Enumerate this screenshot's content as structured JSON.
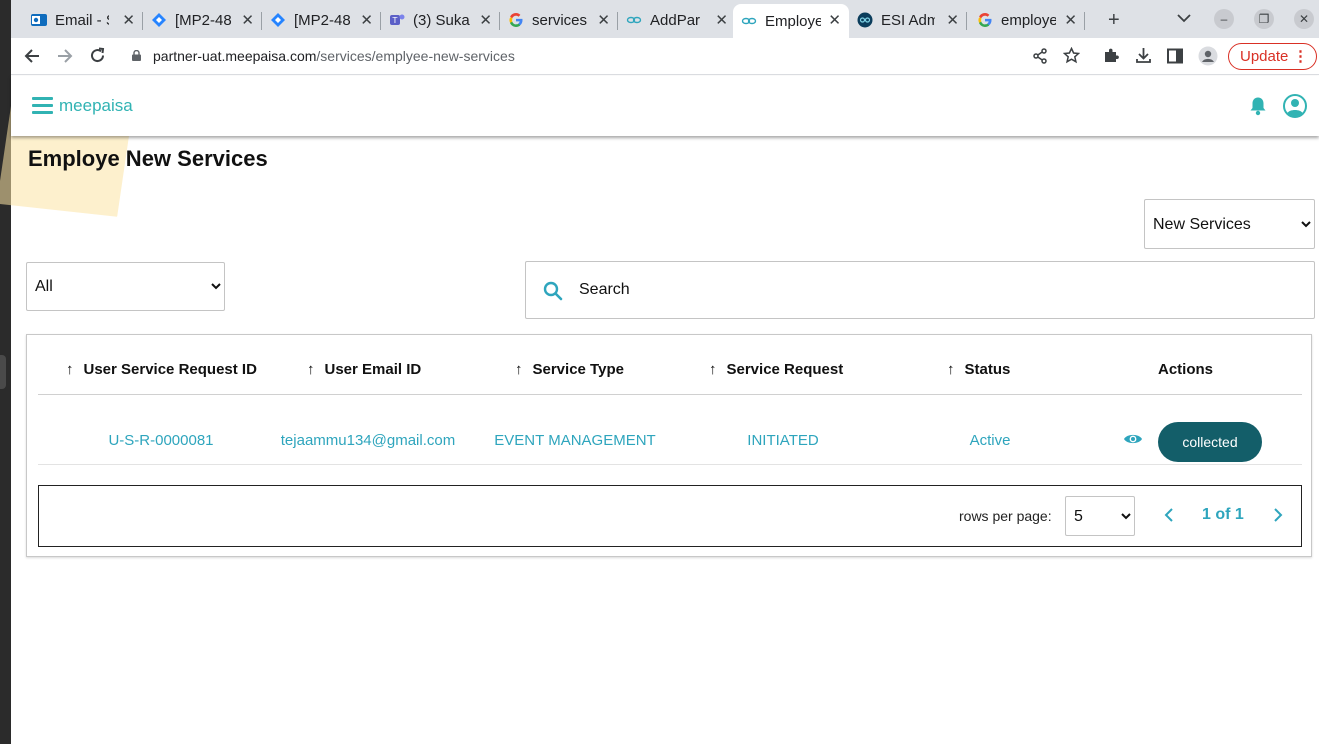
{
  "browser": {
    "tabs": [
      {
        "title": "Email - S",
        "icon": "outlook-icon"
      },
      {
        "title": "[MP2-48",
        "icon": "jira-icon"
      },
      {
        "title": "[MP2-48",
        "icon": "jira-icon"
      },
      {
        "title": "(3) Suka",
        "icon": "teams-icon"
      },
      {
        "title": "services",
        "icon": "google-icon"
      },
      {
        "title": "AddPar",
        "icon": "meepaisa-icon"
      },
      {
        "title": "Employe",
        "icon": "meepaisa-icon",
        "active": true
      },
      {
        "title": "ESI Adm",
        "icon": "esi-icon"
      },
      {
        "title": "employe",
        "icon": "google-icon"
      }
    ],
    "url_host": "partner-uat.meepaisa.com",
    "url_path": "/services/emplyee-new-services",
    "update_label": "Update"
  },
  "app": {
    "brand": "meepaisa",
    "page_title": "Employe New Services",
    "services_select": {
      "selected": "New Services"
    },
    "filter_select": {
      "selected": "All"
    },
    "search": {
      "placeholder": "Search"
    }
  },
  "table": {
    "columns": [
      "User Service Request ID",
      "User Email ID",
      "Service Type",
      "Service Request",
      "Status",
      "Actions"
    ],
    "rows": [
      {
        "request_id": "U-S-R-0000081",
        "email": "tejaammu134@gmail.com",
        "service_type": "EVENT MANAGEMENT",
        "service_request": "INITIATED",
        "status": "Active",
        "action_label": "collected"
      }
    ],
    "pagination": {
      "rows_per_page_label": "rows per page:",
      "rows_per_page": "5",
      "page_info": "1 of 1"
    }
  },
  "colors": {
    "brand": "#31b3b3",
    "link": "#2ea5bd",
    "action_button": "#135e69",
    "update": "#d93025"
  }
}
